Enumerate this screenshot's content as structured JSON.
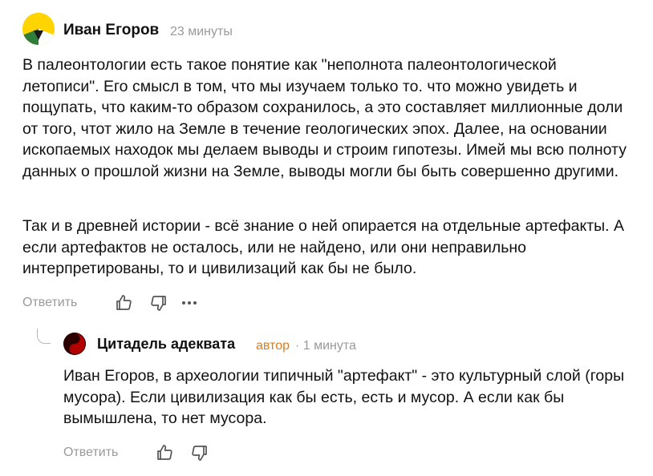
{
  "comment": {
    "author": "Иван Егоров",
    "time": "23 минуты",
    "paragraphs": [
      "В палеонтологии есть такое понятие как \"неполнота палеонтологической летописи\". Его смысл в том, что мы изучаем только то. что можно увидеть и пощупать, что каким-то образом сохранилось, а это составляет миллионные доли от того, чтот жило на Земле в течение геологических эпох. Далее, на основании ископаемых находок мы делаем выводы и строим гипотезы. Имей мы всю полноту данных о прошлой жизни на Земле, выводы могли бы быть совершенно другими.",
      "Так и в древней истории - всё знание о ней опирается на отдельные артефакты. А если артефактов не осталось, или не найдено, или они неправильно интерпретированы, то и цивилизаций как бы не было."
    ],
    "reply_label": "Ответить",
    "like_icon": "thumbs-up-icon",
    "dislike_icon": "thumbs-down-icon",
    "more_icon": "more-dots-icon",
    "avatar_colors": [
      "#ffd400",
      "#2f7d3a",
      "#ffffff",
      "#1a1a1a"
    ]
  },
  "reply": {
    "author": "Цитадель адеквата",
    "badge": "автор",
    "time": "· 1 минута",
    "text": "Иван Егоров, в археологии типичный \"артефакт\" - это культурный слой (горы мусора). Если цивилизация как бы есть, есть и мусор. А если как бы вымышлена, то нет мусора.",
    "reply_label": "Ответить",
    "like_icon": "thumbs-up-icon",
    "dislike_icon": "thumbs-down-icon"
  },
  "colors": {
    "muted": "#9a9a9a",
    "author_badge": "#e07b1a",
    "text": "#111111"
  }
}
